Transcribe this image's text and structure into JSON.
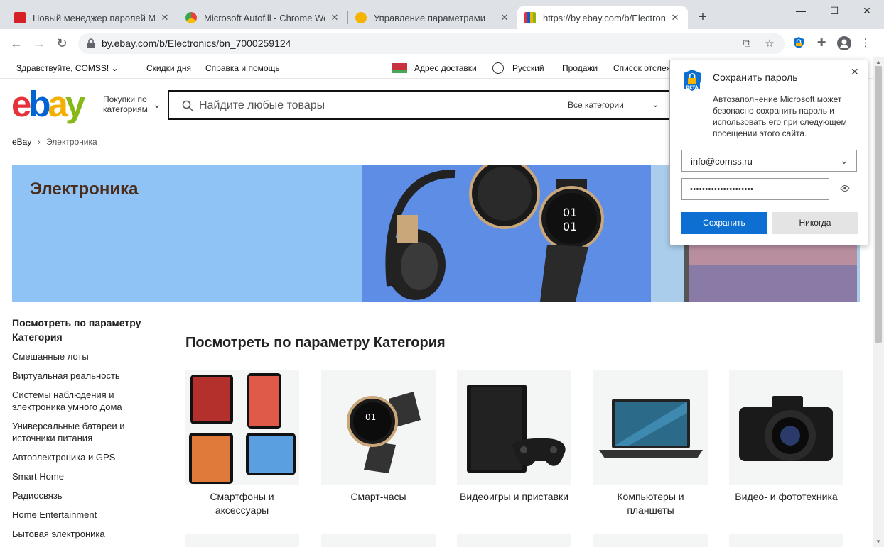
{
  "tabs": [
    {
      "title": "Новый менеджер паролей Micr",
      "favicon_color": "#d62027"
    },
    {
      "title": "Microsoft Autofill - Chrome Web",
      "favicon_color": "#4285f4"
    },
    {
      "title": "Управление параметрами",
      "favicon_color": "#f4b400"
    },
    {
      "title": "https://by.ebay.com/b/Electronic",
      "favicon_color": "#e53238",
      "active": true
    }
  ],
  "window": {
    "new_tab_icon": "plus-icon",
    "minimize_icon": "minimize-icon",
    "maximize_icon": "maximize-icon",
    "close_icon": "close-icon"
  },
  "toolbar": {
    "url": "by.ebay.com/b/Electronics/bn_7000259124"
  },
  "ebay": {
    "topbar": {
      "greeting": "Здравствуйте, COMSS!",
      "deals": "Скидки дня",
      "help": "Справка и помощь",
      "ship_to": "Адрес доставки",
      "language": "Русский",
      "sell": "Продажи",
      "watchlist": "Список отслеж"
    },
    "logo": {
      "e": "e",
      "b": "b",
      "a": "a",
      "y": "y",
      "colors": [
        "#e53238",
        "#0064d2",
        "#f5af02",
        "#86b817"
      ]
    },
    "shop_by": {
      "line1": "Покупки по",
      "line2": "категориям"
    },
    "search": {
      "placeholder": "Найдите любые товары",
      "category": "Все категории"
    },
    "breadcrumb": {
      "home": "eBay",
      "sep": "›",
      "current": "Электроника"
    },
    "banner_title": "Электроника",
    "sidebar": {
      "heading_line1": "Посмотреть по параметру",
      "heading_line2": "Категория",
      "items": [
        {
          "l1": "Смешанные лоты"
        },
        {
          "l1": "Виртуальная реальность"
        },
        {
          "l1": "Системы наблюдения и",
          "l2": "электроника умного дома"
        },
        {
          "l1": "Универсальные батареи и",
          "l2": "источники питания"
        },
        {
          "l1": "Автоэлектроника и GPS"
        },
        {
          "l1": "Smart Home"
        },
        {
          "l1": "Радиосвязь"
        },
        {
          "l1": "Home Entertainment"
        },
        {
          "l1": "Бытовая электроника"
        }
      ]
    },
    "section_title": "Посмотреть по параметру Категория",
    "cards": [
      {
        "l1": "Смартфоны и",
        "l2": "аксессуары"
      },
      {
        "l1": "Смарт-часы",
        "l2": ""
      },
      {
        "l1": "Видеоигры и приставки",
        "l2": ""
      },
      {
        "l1": "Компьютеры и",
        "l2": "планшеты"
      },
      {
        "l1": "Видео- и фототехника",
        "l2": ""
      }
    ]
  },
  "dialog": {
    "title": "Сохранить пароль",
    "desc": "Автозаполнение Microsoft может безопасно сохранить пароль и использовать его при следующем посещении этого сайта.",
    "username": "info@comss.ru",
    "password": "•••••••••••••••••••••",
    "save": "Сохранить",
    "never": "Никогда",
    "badge": "BETA"
  }
}
